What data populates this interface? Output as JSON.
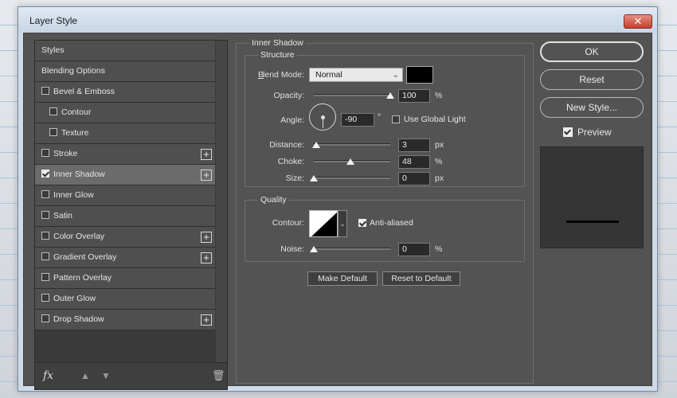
{
  "window": {
    "title": "Layer Style",
    "close_icon": "close-x"
  },
  "styles_list": {
    "items": [
      {
        "label": "Styles",
        "checkbox": false,
        "checked": false,
        "plus": false,
        "indent": false,
        "selected": false
      },
      {
        "label": "Blending Options",
        "checkbox": false,
        "checked": false,
        "plus": false,
        "indent": false,
        "selected": false
      },
      {
        "label": "Bevel & Emboss",
        "checkbox": true,
        "checked": false,
        "plus": false,
        "indent": false,
        "selected": false
      },
      {
        "label": "Contour",
        "checkbox": true,
        "checked": false,
        "plus": false,
        "indent": true,
        "selected": false
      },
      {
        "label": "Texture",
        "checkbox": true,
        "checked": false,
        "plus": false,
        "indent": true,
        "selected": false
      },
      {
        "label": "Stroke",
        "checkbox": true,
        "checked": false,
        "plus": true,
        "indent": false,
        "selected": false
      },
      {
        "label": "Inner Shadow",
        "checkbox": true,
        "checked": true,
        "plus": true,
        "indent": false,
        "selected": true
      },
      {
        "label": "Inner Glow",
        "checkbox": true,
        "checked": false,
        "plus": false,
        "indent": false,
        "selected": false
      },
      {
        "label": "Satin",
        "checkbox": true,
        "checked": false,
        "plus": false,
        "indent": false,
        "selected": false
      },
      {
        "label": "Color Overlay",
        "checkbox": true,
        "checked": false,
        "plus": true,
        "indent": false,
        "selected": false
      },
      {
        "label": "Gradient Overlay",
        "checkbox": true,
        "checked": false,
        "plus": true,
        "indent": false,
        "selected": false
      },
      {
        "label": "Pattern Overlay",
        "checkbox": true,
        "checked": false,
        "plus": false,
        "indent": false,
        "selected": false
      },
      {
        "label": "Outer Glow",
        "checkbox": true,
        "checked": false,
        "plus": false,
        "indent": false,
        "selected": false
      },
      {
        "label": "Drop Shadow",
        "checkbox": true,
        "checked": false,
        "plus": true,
        "indent": false,
        "selected": false
      }
    ],
    "plus_label": "+",
    "bottom": {
      "fx_label": "fx",
      "up_icon": "▲",
      "down_icon": "▼",
      "trash_icon": "🗑"
    }
  },
  "inner_shadow": {
    "group_title": "Inner Shadow",
    "structure_title": "Structure",
    "blend_mode": {
      "label": "Blend Mode:",
      "value": "Normal",
      "color": "#000000"
    },
    "opacity": {
      "label": "Opacity:",
      "value": "100",
      "unit": "%",
      "fraction": 1.0
    },
    "angle": {
      "label": "Angle:",
      "value": "-90",
      "unit": "°",
      "global_light_label": "Use Global Light",
      "global_light_checked": false
    },
    "distance": {
      "label": "Distance:",
      "value": "3",
      "unit": "px",
      "fraction": 0.03
    },
    "choke": {
      "label": "Choke:",
      "value": "48",
      "unit": "%",
      "fraction": 0.48
    },
    "size": {
      "label": "Size:",
      "value": "0",
      "unit": "px",
      "fraction": 0.0
    },
    "quality_title": "Quality",
    "contour": {
      "label": "Contour:",
      "anti_aliased_label": "Anti-aliased",
      "anti_aliased_checked": true
    },
    "noise": {
      "label": "Noise:",
      "value": "0",
      "unit": "%",
      "fraction": 0.0
    },
    "make_default_label": "Make Default",
    "reset_default_label": "Reset to Default"
  },
  "actions": {
    "ok_label": "OK",
    "reset_label": "Reset",
    "new_style_label": "New Style...",
    "preview_label": "Preview",
    "preview_checked": true
  }
}
